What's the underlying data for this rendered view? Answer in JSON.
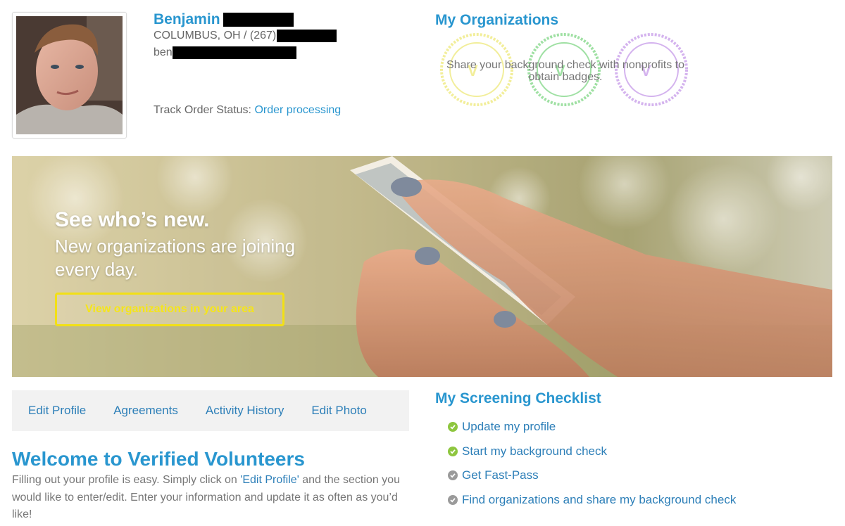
{
  "profile": {
    "first_name": "Benjamin",
    "location_prefix": "COLUMBUS, OH / (267)",
    "email_prefix": "ben",
    "track_label": "Track Order Status:",
    "track_status": "Order processing"
  },
  "organizations": {
    "title": "My Organizations",
    "empty_message": "Share your background check with nonprofits to obtain badges.",
    "badge_colors": [
      "#f2ee9a",
      "#9fe0a3",
      "#d4b3ee"
    ]
  },
  "hero": {
    "heading": "See who’s new.",
    "subheading": "New organizations are joining every day.",
    "button_label": "View organizations in your area"
  },
  "tabs": [
    {
      "label": "Edit Profile"
    },
    {
      "label": "Agreements"
    },
    {
      "label": "Activity History"
    },
    {
      "label": "Edit Photo"
    }
  ],
  "welcome": {
    "title": "Welcome to Verified Volunteers",
    "body_before": "Filling out your profile is easy. Simply click on ",
    "body_link": "'Edit Profile'",
    "body_after": " and the section you would like to enter/edit. Enter your information and update it as often as you’d like!"
  },
  "checklist": {
    "title": "My Screening Checklist",
    "items": [
      {
        "label": "Update my profile",
        "status": "complete"
      },
      {
        "label": "Start my background check",
        "status": "complete"
      },
      {
        "label": "Get Fast-Pass",
        "status": "incomplete"
      },
      {
        "label": "Find organizations and share my background check",
        "status": "incomplete"
      }
    ]
  },
  "colors": {
    "brand_blue": "#2996cf",
    "link_blue": "#2d7fb8",
    "complete_green": "#8ec63f",
    "incomplete_gray": "#9a9a9a",
    "button_yellow": "#f2e015"
  }
}
